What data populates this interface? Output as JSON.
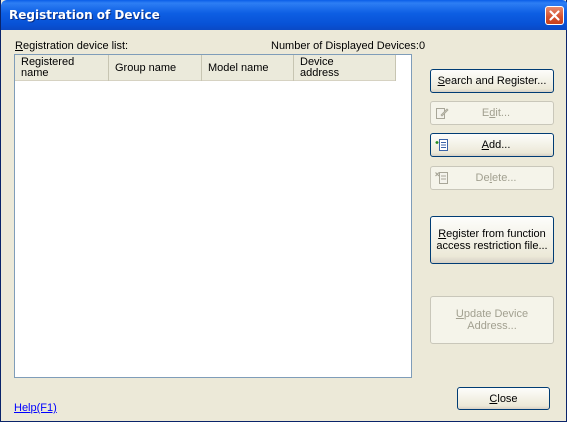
{
  "window": {
    "title": "Registration of Device"
  },
  "labels": {
    "list_label": "Registration device list:",
    "count_label": "Number of Displayed Devices:",
    "count_value": "0"
  },
  "table": {
    "columns": [
      "Registered name",
      "Group name",
      "Model name",
      "Device address"
    ],
    "column_lines": [
      [
        "Registered",
        "name"
      ],
      [
        "Group name"
      ],
      [
        "Model name"
      ],
      [
        "Device",
        "address"
      ]
    ],
    "rows": []
  },
  "buttons": {
    "search_register": "Search and Register...",
    "edit": "Edit...",
    "add": "Add...",
    "delete": "Delete...",
    "register_file_line1": "Register from function",
    "register_file_line2": "access restriction file...",
    "update_address": "Update Device Address...",
    "close": "Close"
  },
  "help": {
    "label": "Help(F1)"
  },
  "icons": {
    "close": "close-icon",
    "edit": "edit-icon",
    "add": "add-icon",
    "delete": "delete-icon"
  }
}
